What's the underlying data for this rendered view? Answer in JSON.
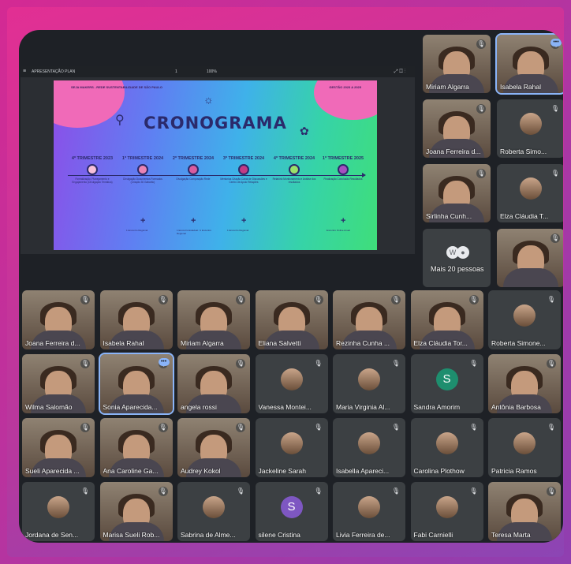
{
  "presentation": {
    "bar_title": "APRESENTAÇÃO PLAN",
    "page_indicator": "1",
    "zoom": "100%",
    "menu_icon": "menu-icon",
    "tools": "⤢ ◫ ⋮",
    "slide": {
      "top_left": "SEJA MAKERS - REDE SUSTENTABILIDADE DE SÃO PAULO",
      "top_right": "GESTÃO 2023 A 2025",
      "title": "CRONOGRAMA",
      "steps": [
        {
          "label": "4º TRIMESTRE 2023",
          "desc": "Formalização, Planejamento e Engajamento (Divulgação Temática)",
          "color": "#f7c0d9",
          "below": ""
        },
        {
          "label": "1º TRIMESTRE 2024",
          "desc": "Divulgação Documentos Formados (Criação 30 Gabarito)",
          "color": "#e983b4",
          "below": "1 Encontro Regional"
        },
        {
          "label": "2º TRIMESTRE 2024",
          "desc": "Divulgação Composição Rede",
          "color": "#d95c9f",
          "below": "1 Encontro Estadual / 1 Encontro Regional"
        },
        {
          "label": "3º TRIMESTRE 2024",
          "desc": "Mentorias Criação Canal de Discussões e Centro de Apoio Relações",
          "color": "#c23b85",
          "below": "1 Encontro Regional"
        },
        {
          "label": "4º TRIMESTRE 2024",
          "desc": "Relatório Monitoramento e Análise dos resultados",
          "color": "#9be06a",
          "below": ""
        },
        {
          "label": "1º TRIMESTRE 2025",
          "desc": "Finalização Conclusão Resultados",
          "color": "#a64fbf",
          "below": "Encontro Online Anual"
        }
      ]
    }
  },
  "tiles": {
    "top": [
      {
        "name": "Miriam Algarra",
        "photo": true
      },
      {
        "name": "Isabela Rahal",
        "photo": true,
        "speaking": true
      },
      {
        "name": "Joana Ferreira d...",
        "photo": true
      },
      {
        "name": "Roberta Simo...",
        "photo": false
      },
      {
        "name": "Sirlinha Cunh...",
        "photo": true
      },
      {
        "name": "Elza Cláudia T...",
        "photo": false
      },
      {
        "name": "Mais 20 pessoas",
        "photo": false,
        "more": true
      },
      {
        "name": "",
        "photo": true
      }
    ],
    "grid": [
      {
        "name": "Joana Ferreira d...",
        "photo": true
      },
      {
        "name": "Isabela Rahal",
        "photo": true
      },
      {
        "name": "Miriam Algarra",
        "photo": true
      },
      {
        "name": "Eliana Salvetti",
        "photo": true
      },
      {
        "name": "Rezinha Cunha ...",
        "photo": true
      },
      {
        "name": "Elza Cláudia Tor...",
        "photo": true
      },
      {
        "name": "Roberta Simone...",
        "photo": false
      },
      {
        "name": "Wilma Salomão",
        "photo": true
      },
      {
        "name": "Sonia Aparecida...",
        "photo": true,
        "speaking": true
      },
      {
        "name": "angela rossi",
        "photo": true
      },
      {
        "name": "Vanessa Montei...",
        "photo": false
      },
      {
        "name": "Maria Virginia Al...",
        "photo": false
      },
      {
        "name": "Sandra Amorim",
        "photo": false,
        "letter": "S"
      },
      {
        "name": "Antônia Barbosa",
        "photo": true
      },
      {
        "name": "Sueli Aparecida ...",
        "photo": true
      },
      {
        "name": "Ana Caroline Ga...",
        "photo": true
      },
      {
        "name": "Audrey Kokol",
        "photo": true
      },
      {
        "name": "Jackeline Sarah",
        "photo": false
      },
      {
        "name": "Isabella Apareci...",
        "photo": false
      },
      {
        "name": "Carolina Plothow",
        "photo": false
      },
      {
        "name": "Patricia Ramos",
        "photo": false
      },
      {
        "name": "Jordana de Sen...",
        "photo": false
      },
      {
        "name": "Marisa Sueli Rob...",
        "photo": true
      },
      {
        "name": "Sabrina de Alme...",
        "photo": false
      },
      {
        "name": "silene Cristina",
        "photo": false,
        "letter": "S",
        "letter_purple": true
      },
      {
        "name": "Livia Ferreira de...",
        "photo": false
      },
      {
        "name": "Fabi Carnielli",
        "photo": false
      },
      {
        "name": "Teresa Marta",
        "photo": true
      }
    ]
  }
}
